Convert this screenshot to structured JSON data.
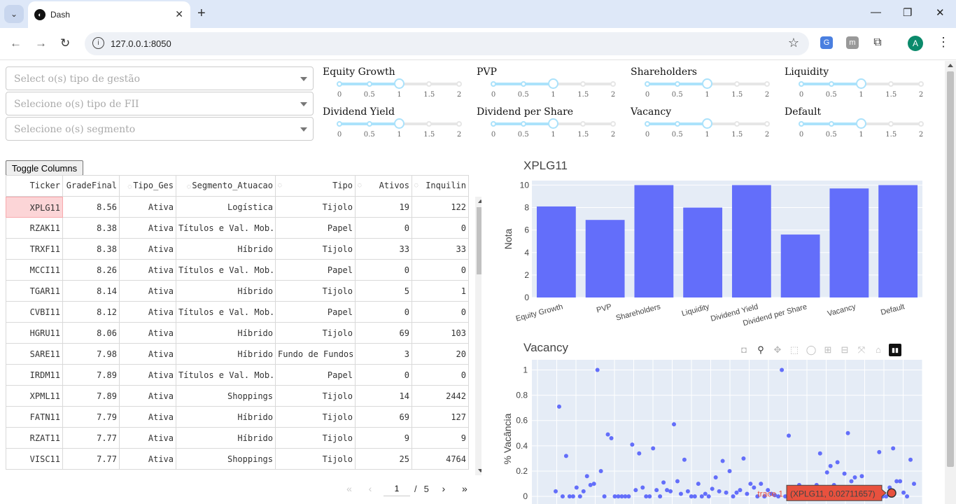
{
  "browser": {
    "tab_title": "Dash",
    "url": "127.0.0.1:8050",
    "avatar_letter": "A"
  },
  "filters": [
    {
      "placeholder": "Select o(s) tipo de gestão"
    },
    {
      "placeholder": "Selecione o(s) tipo de FII"
    },
    {
      "placeholder": "Selecione o(s) segmento"
    }
  ],
  "sliders": {
    "marks": [
      "0",
      "0.5",
      "1",
      "1.5",
      "2"
    ],
    "items": [
      {
        "label": "Equity Growth",
        "value": 1
      },
      {
        "label": "PVP",
        "value": 1
      },
      {
        "label": "Shareholders",
        "value": 1
      },
      {
        "label": "Liquidity",
        "value": 1
      },
      {
        "label": "Dividend Yield",
        "value": 1
      },
      {
        "label": "Dividend per Share",
        "value": 1
      },
      {
        "label": "Vacancy",
        "value": 1
      },
      {
        "label": "Default",
        "value": 1
      }
    ]
  },
  "toggle_label": "Toggle Columns",
  "table": {
    "columns": [
      "Ticker",
      "GradeFinal",
      "Tipo_Ges",
      "Segmento_Atuacao",
      "Tipo",
      "Ativos",
      "Inquilin"
    ],
    "rows": [
      [
        "XPLG11",
        "8.56",
        "Ativa",
        "Logística",
        "Tijolo",
        "19",
        "122"
      ],
      [
        "RZAK11",
        "8.38",
        "Ativa",
        "Títulos e Val. Mob.",
        "Papel",
        "0",
        "0"
      ],
      [
        "TRXF11",
        "8.38",
        "Ativa",
        "Híbrido",
        "Tijolo",
        "33",
        "33"
      ],
      [
        "MCCI11",
        "8.26",
        "Ativa",
        "Títulos e Val. Mob.",
        "Papel",
        "0",
        "0"
      ],
      [
        "TGAR11",
        "8.14",
        "Ativa",
        "Híbrido",
        "Tijolo",
        "5",
        "1"
      ],
      [
        "CVBI11",
        "8.12",
        "Ativa",
        "Títulos e Val. Mob.",
        "Papel",
        "0",
        "0"
      ],
      [
        "HGRU11",
        "8.06",
        "Ativa",
        "Híbrido",
        "Tijolo",
        "69",
        "103"
      ],
      [
        "SARE11",
        "7.98",
        "Ativa",
        "Híbrido",
        "Fundo de Fundos",
        "3",
        "20"
      ],
      [
        "IRDM11",
        "7.89",
        "Ativa",
        "Títulos e Val. Mob.",
        "Papel",
        "0",
        "0"
      ],
      [
        "XPML11",
        "7.89",
        "Ativa",
        "Shoppings",
        "Tijolo",
        "14",
        "2442"
      ],
      [
        "FATN11",
        "7.79",
        "Ativa",
        "Híbrido",
        "Tijolo",
        "69",
        "127"
      ],
      [
        "RZAT11",
        "7.77",
        "Ativa",
        "Híbrido",
        "Tijolo",
        "9",
        "9"
      ],
      [
        "VISC11",
        "7.77",
        "Ativa",
        "Shoppings",
        "Tijolo",
        "25",
        "4764"
      ]
    ],
    "page_current": "1",
    "page_sep": "/",
    "page_total": "5"
  },
  "chart_data": [
    {
      "type": "bar",
      "title": "XPLG11",
      "ylabel": "Nota",
      "xlabel": "",
      "categories": [
        "Equity Growth",
        "PVP",
        "Shareholders",
        "Liquidity",
        "Dividend Yield",
        "Dividend per Share",
        "Vacancy",
        "Default"
      ],
      "values": [
        8.1,
        6.9,
        10,
        8.0,
        10,
        5.6,
        9.7,
        10
      ],
      "ylim": [
        0,
        10.4
      ],
      "yticks": [
        0,
        2,
        4,
        6,
        8,
        10
      ],
      "color": "#636efa",
      "grid": true
    },
    {
      "type": "scatter",
      "title": "Vacancy",
      "ylabel": "% Vacância",
      "xlabel": "",
      "ylim": [
        -0.06,
        1.08
      ],
      "yticks": [
        0,
        0.2,
        0.4,
        0.6,
        0.8,
        1
      ],
      "ytick_labels": [
        "0",
        "0.2",
        "0.4",
        "0.6",
        "0.8",
        "1"
      ],
      "color": "#636efa",
      "grid": true,
      "y": [
        0.04,
        0.71,
        0.0,
        0.32,
        0.0,
        0.0,
        0.07,
        0.0,
        0.04,
        0.16,
        0.09,
        0.1,
        1.0,
        0.2,
        0.0,
        0.49,
        0.46,
        0.0,
        0.0,
        0.0,
        0.0,
        0.0,
        0.41,
        0.05,
        0.34,
        0.07,
        0.0,
        0.0,
        0.38,
        0.05,
        0.0,
        0.11,
        0.05,
        0.04,
        0.57,
        0.12,
        0.02,
        0.29,
        0.04,
        0.0,
        0.0,
        0.1,
        0.0,
        0.02,
        0.0,
        0.06,
        0.15,
        0.04,
        0.28,
        0.03,
        0.2,
        0.0,
        0.03,
        0.05,
        0.3,
        0.02,
        0.1,
        0.07,
        0.0,
        0.1,
        0.0,
        0.05,
        0.02,
        0.01,
        0.0,
        1.0,
        0.0,
        0.48,
        0.05,
        0.0,
        0.09,
        0.03,
        0.0,
        0.0,
        0.0,
        0.09,
        0.34,
        0.0,
        0.19,
        0.24,
        0.09,
        0.27,
        0.01,
        0.18,
        0.5,
        0.12,
        0.15,
        0.07,
        0.16,
        0.0,
        0.0,
        0.0,
        0.0,
        0.35,
        0.0,
        0.0,
        0.07,
        0.38,
        0.12,
        0.12,
        0.03,
        0.0,
        0.29,
        0.1
      ],
      "tooltip": {
        "trace": "trace 1",
        "text": "(XPLG11, 0.02711657)"
      }
    }
  ],
  "modebar": [
    "camera-icon",
    "zoom-icon",
    "pan-icon",
    "box-select-icon",
    "lasso-icon",
    "zoom-in-icon",
    "zoom-out-icon",
    "autoscale-icon",
    "home-icon",
    "plotly-logo-icon"
  ]
}
